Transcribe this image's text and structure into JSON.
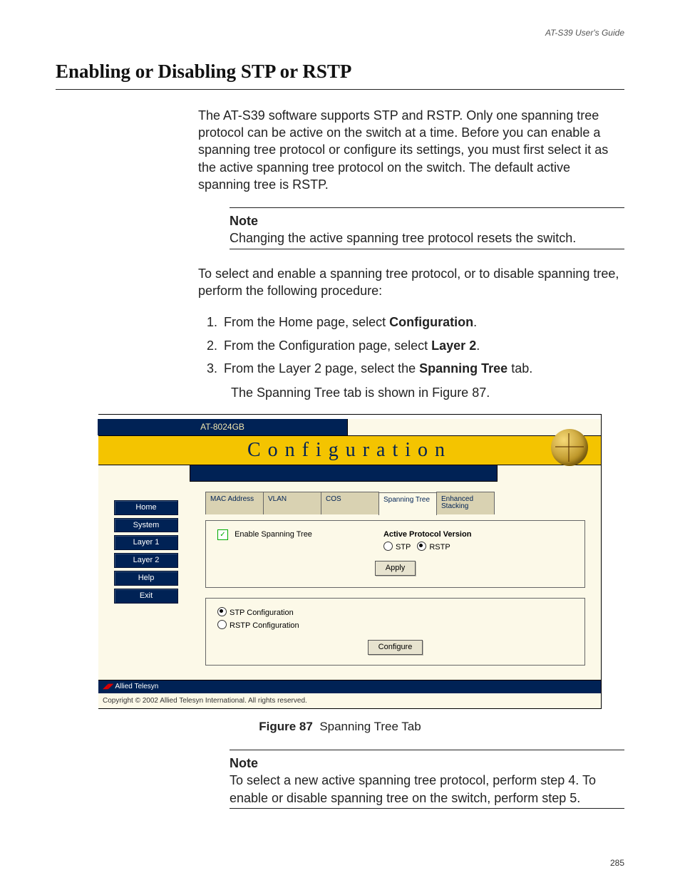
{
  "header": {
    "running": "AT-S39 User's Guide"
  },
  "section": {
    "title": "Enabling or Disabling STP or RSTP",
    "intro": "The AT-S39 software supports STP and RSTP. Only one spanning tree protocol can be active on the switch at a time. Before you can enable a spanning tree protocol or configure its settings, you must first select it as the active spanning tree protocol on the switch. The default active spanning tree is RSTP.",
    "note1": {
      "label": "Note",
      "text": "Changing the active spanning tree protocol resets the switch."
    },
    "leadin": "To select and enable a spanning tree protocol, or to disable spanning tree, perform the following procedure:",
    "steps": [
      {
        "pre": "From the Home page, select ",
        "bold": "Configuration",
        "post": "."
      },
      {
        "pre": "From the Configuration page, select ",
        "bold": "Layer 2",
        "post": "."
      },
      {
        "pre": "From the Layer 2 page, select the ",
        "bold": "Spanning Tree",
        "post": " tab."
      }
    ],
    "step_cont": "The Spanning Tree tab is shown in Figure 87.",
    "note2": {
      "label": "Note",
      "text": "To select a new active spanning tree protocol, perform step 4. To enable or disable spanning tree on the switch, perform step 5."
    }
  },
  "figure": {
    "device": "AT-8024GB",
    "title": "Configuration",
    "sidebar": [
      "Home",
      "System",
      "Layer 1",
      "Layer 2",
      "Help",
      "Exit"
    ],
    "tabs": [
      "MAC Address",
      "VLAN",
      "COS",
      "Spanning Tree",
      "Enhanced Stacking"
    ],
    "enable_label": "Enable Spanning Tree",
    "apv_title": "Active Protocol Version",
    "apv_options": [
      "STP",
      "RSTP"
    ],
    "apply": "Apply",
    "cfg_options": [
      "STP Configuration",
      "RSTP Configuration"
    ],
    "configure": "Configure",
    "vendor": "Allied Telesyn",
    "copyright": "Copyright © 2002 Allied Telesyn International. All rights reserved.",
    "caption_bold": "Figure 87",
    "caption_rest": "Spanning Tree Tab"
  },
  "footer": {
    "page": "285"
  }
}
